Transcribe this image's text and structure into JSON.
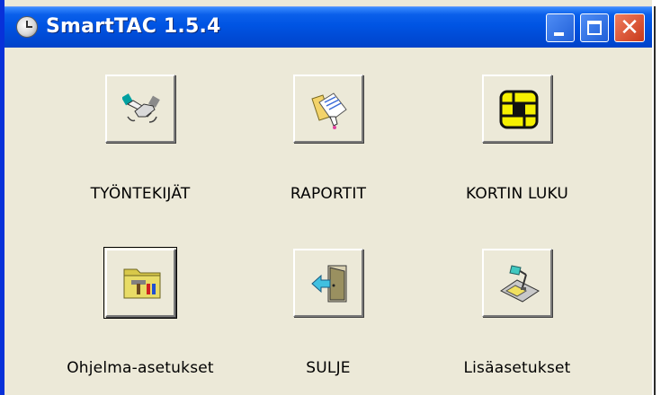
{
  "window": {
    "title": "SmartTAC 1.5.4",
    "app_icon": "clock-icon",
    "controls": {
      "minimize": "minimize-icon",
      "maximize": "maximize-icon",
      "close_glyph": "✕"
    }
  },
  "buttons": [
    {
      "id": "employees",
      "label": "TYÖNTEKIJÄT",
      "icon": "handshake-icon"
    },
    {
      "id": "reports",
      "label": "RAPORTIT",
      "icon": "documents-icon"
    },
    {
      "id": "card-read",
      "label": "KORTIN LUKU",
      "icon": "smartcard-chip-icon"
    },
    {
      "id": "settings",
      "label": "Ohjelma-asetukset",
      "icon": "tools-folder-icon"
    },
    {
      "id": "close",
      "label": "SULJE",
      "icon": "exit-door-icon"
    },
    {
      "id": "extra-settings",
      "label": "Lisäasetukset",
      "icon": "desk-lamp-icon"
    }
  ],
  "colors": {
    "titlebar": "#0054E3",
    "face": "#ECE9D8",
    "close_button": "#D6492A"
  }
}
